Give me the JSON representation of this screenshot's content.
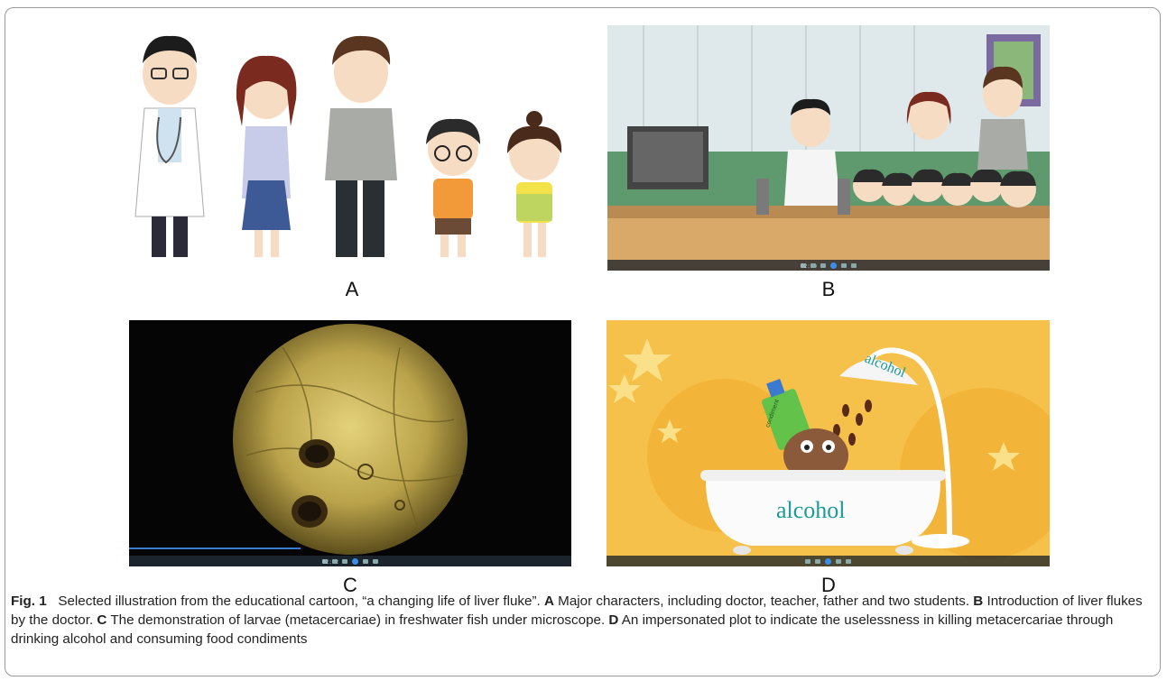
{
  "panels": {
    "a": {
      "label": "A"
    },
    "b": {
      "label": "B",
      "video_time": "02:40"
    },
    "c": {
      "label": "C",
      "video_time": "02:42"
    },
    "d": {
      "label": "D",
      "bottle_word": "alcohol",
      "tub_word": "alcohol",
      "bottle_tag": "condiment"
    }
  },
  "caption": {
    "fig_label": "Fig. 1",
    "intro": "Selected illustration from the educational cartoon, “a changing life of liver fluke”.",
    "parts": [
      {
        "key": "A",
        "text": "Major characters, including doctor, teacher, father and two students."
      },
      {
        "key": "B",
        "text": "Introduction of liver flukes by the doctor."
      },
      {
        "key": "C",
        "text": "The demonstration of larvae (metacercariae) in freshwater fish under microscope."
      },
      {
        "key": "D",
        "text": "An impersonated plot to indicate the uselessness in killing metacercariae through drinking alcohol and consuming food condiments"
      }
    ]
  },
  "colors": {
    "panel_d_bg": "#f6c14a",
    "panel_c_bg": "#050505",
    "microscope_field": "#b9a24a",
    "video_bar": "#1b2733",
    "play_button": "#3a8ee8"
  }
}
